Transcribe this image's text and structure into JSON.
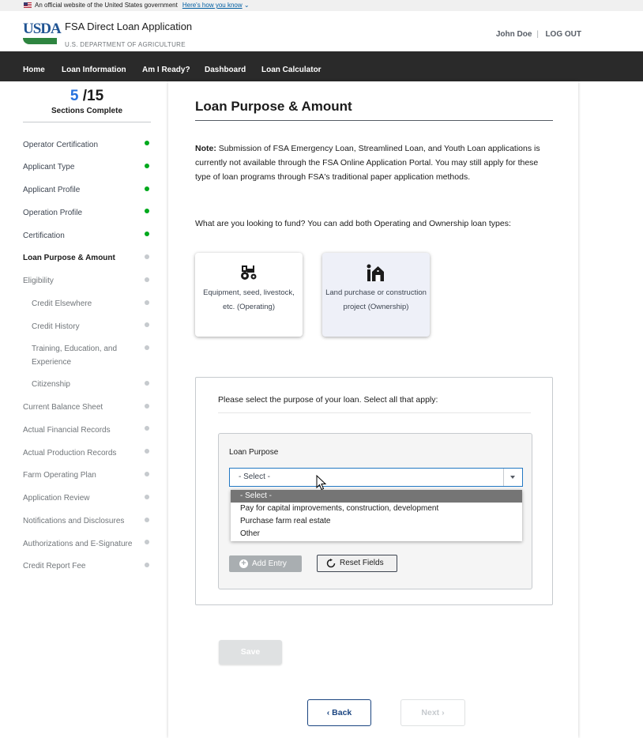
{
  "gov_banner": {
    "text": "An official website of the United States government",
    "link": "Here's how you know"
  },
  "header": {
    "app_title": "FSA Direct Loan Application",
    "logo_text": "USDA",
    "department": "U.S. DEPARTMENT OF AGRICULTURE",
    "user_name": "John Doe",
    "separator": "|",
    "logout": "LOG OUT"
  },
  "nav": {
    "items": [
      "Home",
      "Loan Information",
      "Am I Ready?",
      "Dashboard",
      "Loan Calculator"
    ]
  },
  "sidebar": {
    "current": "5",
    "total": "/15",
    "label": "Sections Complete",
    "items": [
      {
        "label": "Operator Certification",
        "status": "complete"
      },
      {
        "label": "Applicant Type",
        "status": "complete"
      },
      {
        "label": "Applicant Profile",
        "status": "complete"
      },
      {
        "label": "Operation Profile",
        "status": "complete"
      },
      {
        "label": "Certification",
        "status": "complete"
      },
      {
        "label": "Loan Purpose & Amount",
        "status": "current"
      },
      {
        "label": "Eligibility",
        "status": "incomplete"
      },
      {
        "label": "Credit Elsewhere",
        "status": "incomplete"
      },
      {
        "label": "Credit History",
        "status": "incomplete"
      },
      {
        "label": "Training, Education, and Experience",
        "status": "incomplete"
      },
      {
        "label": "Citizenship",
        "status": "incomplete"
      },
      {
        "label": "Current Balance Sheet",
        "status": "incomplete"
      },
      {
        "label": "Actual Financial Records",
        "status": "incomplete"
      },
      {
        "label": "Actual Production Records",
        "status": "incomplete"
      },
      {
        "label": "Farm Operating Plan",
        "status": "incomplete"
      },
      {
        "label": "Application Review",
        "status": "incomplete"
      },
      {
        "label": "Notifications and Disclosures",
        "status": "incomplete"
      },
      {
        "label": "Authorizations and E-Signature",
        "status": "incomplete"
      },
      {
        "label": "Credit Report Fee",
        "status": "incomplete"
      }
    ]
  },
  "main": {
    "title": "Loan Purpose & Amount",
    "note_label": "Note:",
    "note_text": "Submission of FSA Emergency Loan, Streamlined Loan, and Youth Loan applications is currently not available through the FSA Online Application Portal. You may still apply for these type of loan programs through FSA's traditional paper application methods.",
    "fund_question": "What are you looking to fund? You can add both Operating and Ownership loan types:",
    "cards": [
      {
        "label": "Equipment, seed, livestock, etc. (Operating)",
        "icon": "tractor-icon"
      },
      {
        "label": "Land purchase or construction project (Ownership)",
        "icon": "barn-icon"
      }
    ],
    "purpose_question": "Please select the purpose of your loan. Select all that apply:",
    "loan_purpose_label": "Loan Purpose",
    "select_value": "- Select -",
    "dropdown_options": [
      "- Select -",
      "Pay for capital improvements, construction, development",
      "Purchase farm real estate",
      "Other"
    ],
    "add_entry": "Add Entry",
    "reset_fields": "Reset Fields",
    "save": "Save",
    "back": "Back",
    "next": "Next"
  },
  "colors": {
    "nav_bg": "#2a2a2a",
    "complete_dot": "#00a91c",
    "incomplete_dot": "#c6cace",
    "accent": "#2672de",
    "primary_button": "#1a4480"
  }
}
